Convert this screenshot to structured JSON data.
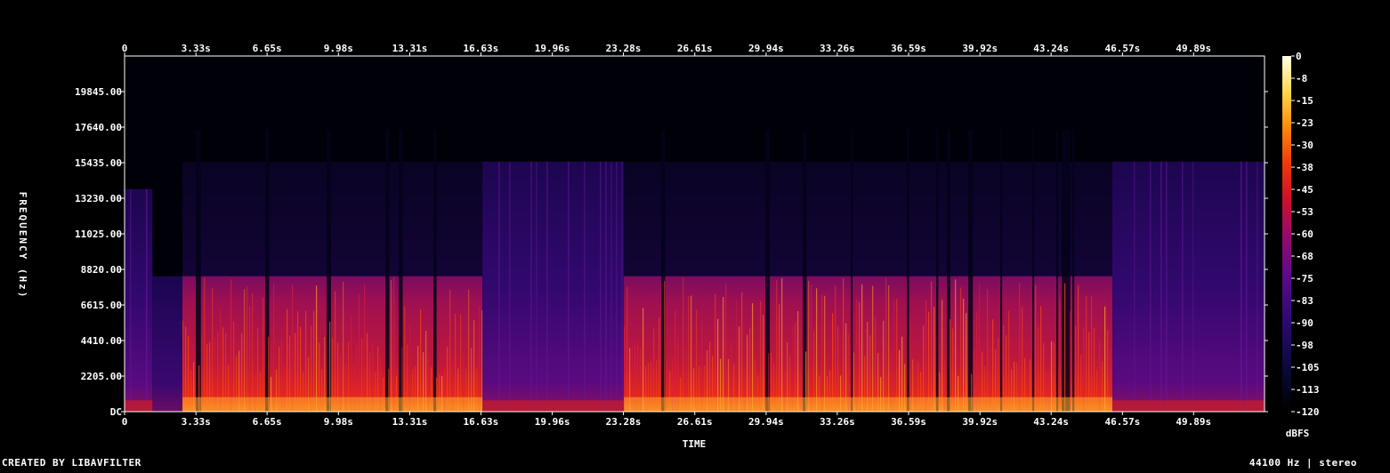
{
  "chart_data": {
    "type": "heatmap",
    "title": "",
    "xlabel": "TIME",
    "ylabel": "FREQUENCY (Hz)",
    "x_tick_labels": [
      "0",
      "3.33s",
      "6.65s",
      "9.98s",
      "13.31s",
      "16.63s",
      "19.96s",
      "23.28s",
      "26.61s",
      "29.94s",
      "33.26s",
      "36.59s",
      "39.92s",
      "43.24s",
      "46.57s",
      "49.89s"
    ],
    "x_ticks_seconds": [
      0,
      3.33,
      6.65,
      9.98,
      13.31,
      16.63,
      19.96,
      23.28,
      26.61,
      29.94,
      33.26,
      36.59,
      39.92,
      43.24,
      46.57,
      49.89
    ],
    "xlim": [
      0,
      53.2
    ],
    "y_tick_labels": [
      "DC",
      "2205.00",
      "4410.00",
      "6615.00",
      "8820.00",
      "11025.00",
      "13230.00",
      "15435.00",
      "17640.00",
      "19845.00"
    ],
    "y_ticks_hz": [
      0,
      2205,
      4410,
      6615,
      8820,
      11025,
      13230,
      15435,
      17640,
      19845
    ],
    "ylim": [
      0,
      22050
    ],
    "colorbar": {
      "label": "dBFS",
      "tick_labels": [
        "0",
        "-8",
        "-15",
        "-23",
        "-30",
        "-38",
        "-45",
        "-53",
        "-60",
        "-68",
        "-75",
        "-83",
        "-90",
        "-98",
        "-105",
        "-113",
        "-120"
      ],
      "range": [
        -120,
        0
      ]
    },
    "segments": [
      {
        "start": 0.0,
        "end": 1.3,
        "kind": "music_intro",
        "bandwidth_hz": 13800
      },
      {
        "start": 1.3,
        "end": 2.7,
        "kind": "quiet",
        "bandwidth_hz": 8400
      },
      {
        "start": 2.7,
        "end": 16.7,
        "kind": "speech",
        "bandwidth_hz": 8400
      },
      {
        "start": 16.7,
        "end": 23.3,
        "kind": "music",
        "bandwidth_hz": 15500
      },
      {
        "start": 23.3,
        "end": 46.1,
        "kind": "speech",
        "bandwidth_hz": 8400
      },
      {
        "start": 46.1,
        "end": 53.2,
        "kind": "music_outro",
        "bandwidth_hz": 15500
      }
    ],
    "grid": false
  },
  "footer": {
    "credit": "CREATED BY LIBAVFILTER",
    "format": "44100 Hz | stereo"
  }
}
